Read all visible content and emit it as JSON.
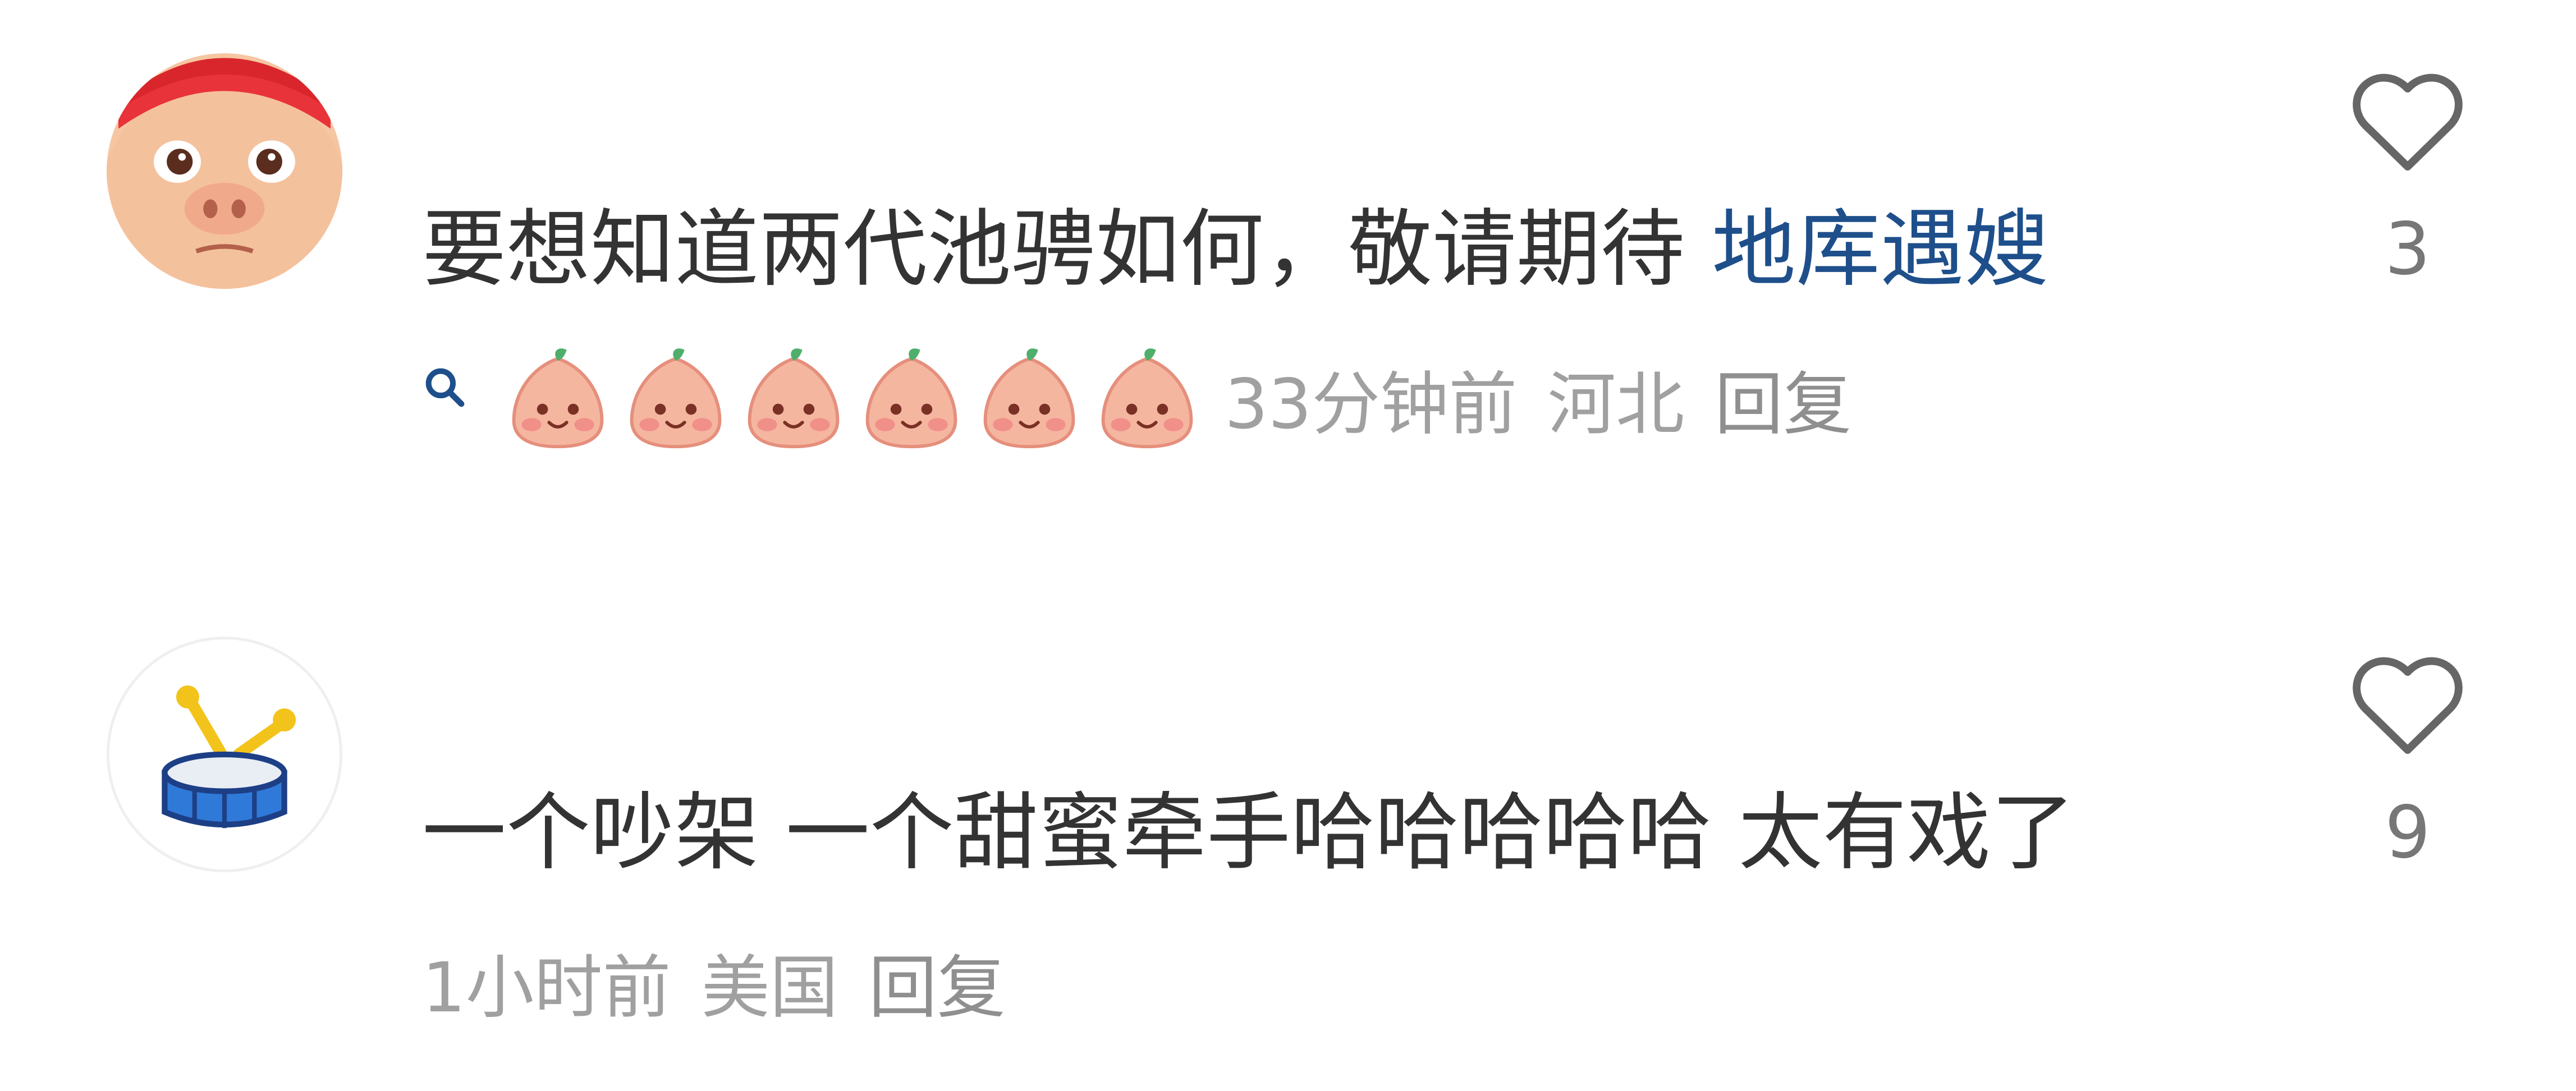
{
  "comments": [
    {
      "avatar_icon": "pig-face-avatar-icon",
      "text": "要想知道两代池骋如何，敬请期待",
      "topic_link": "地库遇嫂",
      "topic_color": "#1e4f8b",
      "search_icon": "search-icon",
      "emoji_name": "peach-face-emoji",
      "emoji_count": 6,
      "time": "33分钟前",
      "location": "河北",
      "reply_label": "回复",
      "like_icon": "heart-outline-icon",
      "like_count": "3"
    },
    {
      "avatar_icon": "drum-avatar-icon",
      "text": "一个吵架 一个甜蜜牵手哈哈哈哈哈 太有戏了",
      "time": "1小时前",
      "location": "美国",
      "reply_label": "回复",
      "like_icon": "heart-outline-icon",
      "like_count": "9"
    }
  ],
  "colors": {
    "body_text": "#333333",
    "meta_text": "#a0a0a0",
    "like_count": "#777777",
    "heart_stroke": "#666666"
  }
}
